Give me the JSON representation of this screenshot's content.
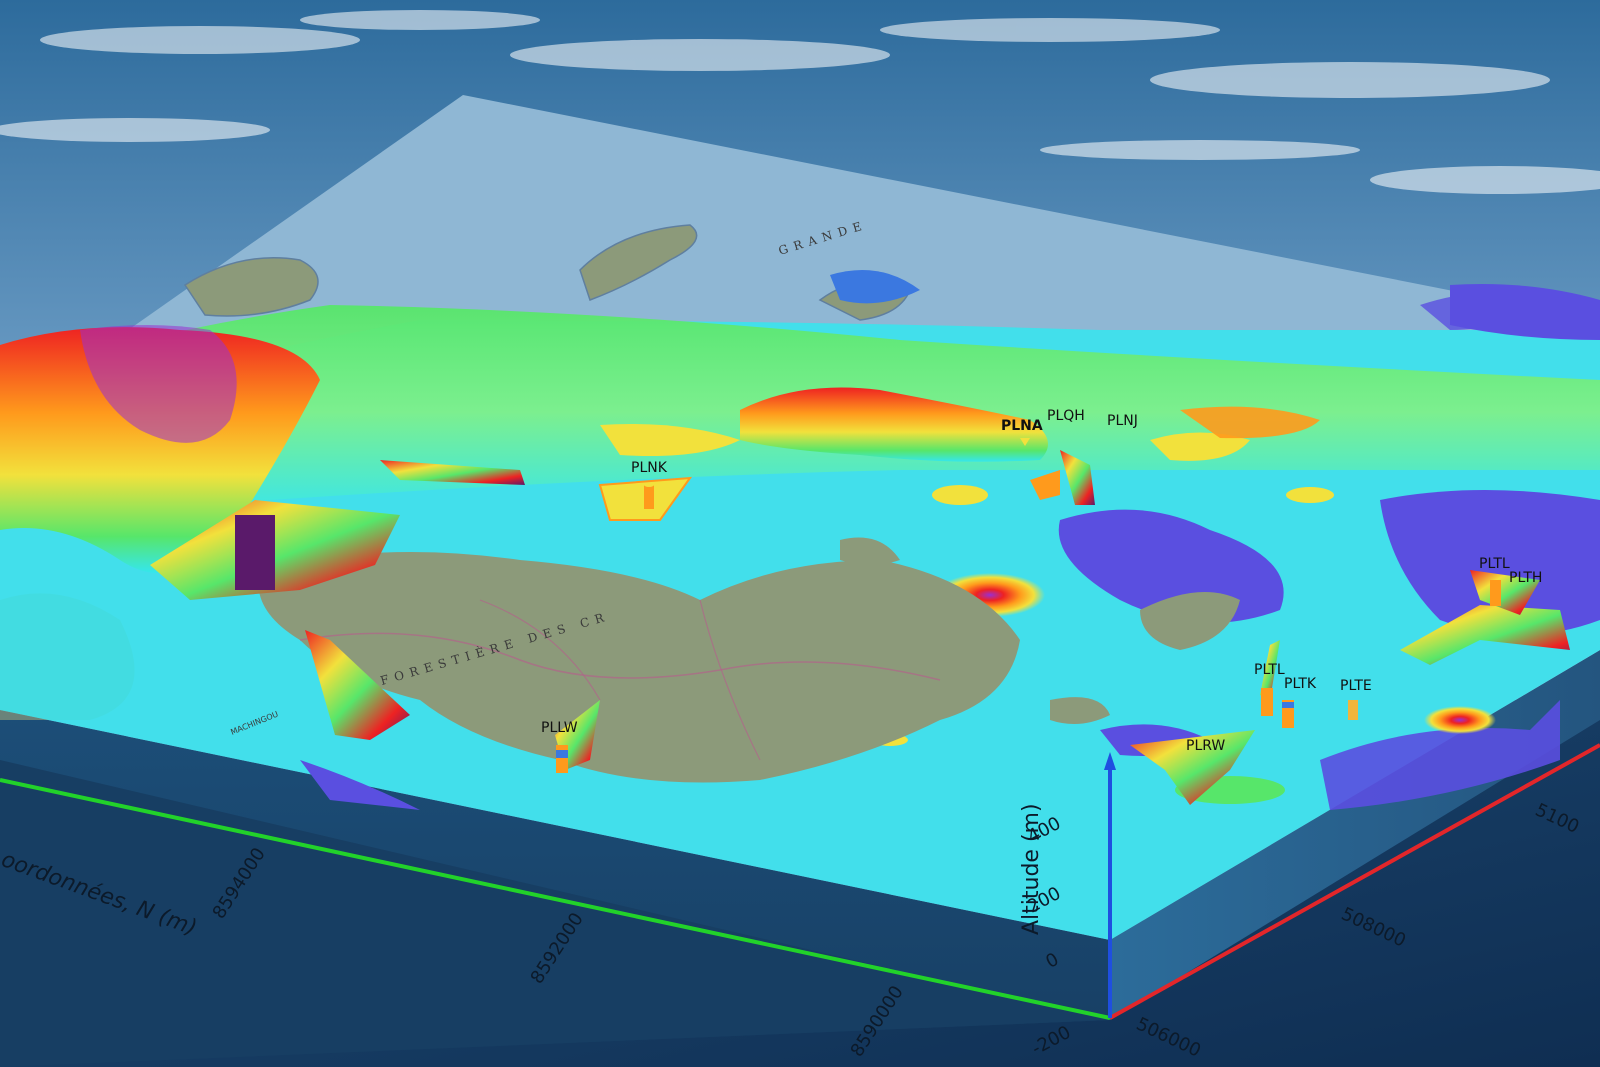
{
  "scene": {
    "colors": {
      "sky_top": "#2d6b9c",
      "sky_bottom": "#b9d3e6",
      "ocean": "#173b62",
      "map_sea": "#8fb7d4",
      "land": "#8c9a7a",
      "cyan": "#35e6ef",
      "blue_violet": "#5a4fe0",
      "green": "#57e66a",
      "yellow": "#f2e13c",
      "orange": "#ff9a1c",
      "red": "#ee2222",
      "magenta": "#9a2fd0",
      "x_axis": "#e3262a",
      "y_axis": "#22d22a",
      "z_axis": "#1f4fe0"
    },
    "map_labels": {
      "sea": "GRANDE",
      "reserve": "RVE FORESTIÈRE DES CR",
      "west": "MACHINGOU"
    },
    "stations": [
      {
        "id": "plna",
        "label": "PLNA",
        "bold": true
      },
      {
        "id": "plqh",
        "label": "PLQH"
      },
      {
        "id": "plnj",
        "label": "PLNJ"
      },
      {
        "id": "plnk",
        "label": "PLNK"
      },
      {
        "id": "pllw",
        "label": "PLLW"
      },
      {
        "id": "plrw",
        "label": "PLRW"
      },
      {
        "id": "pltl",
        "label": "PLTL"
      },
      {
        "id": "plth",
        "label": "PLTH"
      },
      {
        "id": "pltl2",
        "label": "PLTL"
      },
      {
        "id": "pltk",
        "label": "PLTK"
      },
      {
        "id": "plte",
        "label": "PLTE"
      }
    ],
    "axes": {
      "y_title": "oordonnées, N (m)",
      "y_ticks": [
        "8594000",
        "8592000",
        "8590000"
      ],
      "x_ticks": [
        "506000",
        "508000",
        "5100"
      ],
      "z_title": "Altitude (m)",
      "z_ticks": [
        "400",
        "200",
        "0",
        "-200"
      ]
    }
  }
}
